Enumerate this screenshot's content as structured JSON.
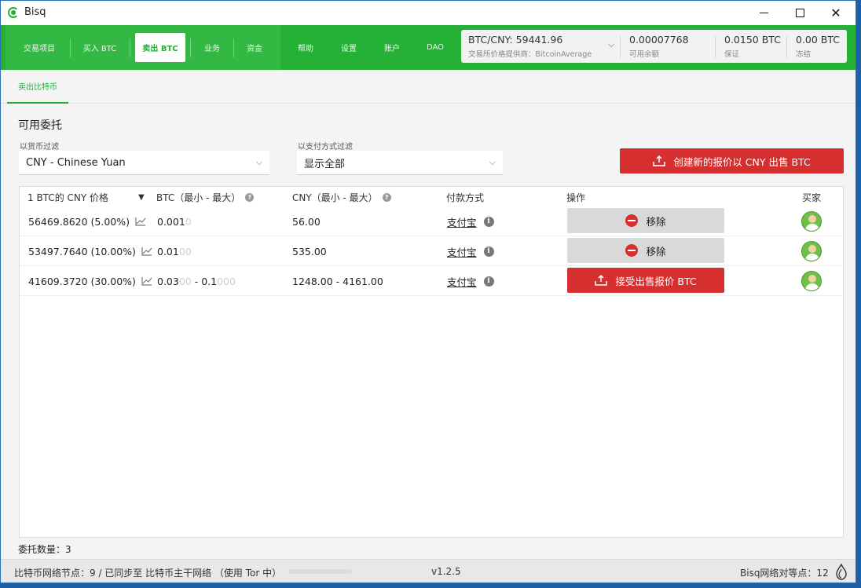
{
  "window": {
    "title": "Bisq"
  },
  "nav": {
    "items": [
      {
        "label": "交易项目"
      },
      {
        "label": "买入 BTC"
      },
      {
        "label": "卖出 BTC"
      },
      {
        "label": "业务"
      },
      {
        "label": "资金"
      },
      {
        "label": "帮助"
      },
      {
        "label": "设置"
      },
      {
        "label": "账户"
      },
      {
        "label": "DAO"
      }
    ],
    "active_index": 2
  },
  "balances": {
    "price": {
      "value": "BTC/CNY: 59441.96",
      "label": "交易所价格提供商：BitcoinAverage"
    },
    "available": {
      "value": "0.00007768",
      "label": "可用余额"
    },
    "reserved": {
      "value": "0.0150 BTC",
      "label": "保证"
    },
    "locked": {
      "value": "0.00 BTC",
      "label": "冻结"
    }
  },
  "subtab": {
    "label": "卖出比特币"
  },
  "section": {
    "title": "可用委托"
  },
  "filters": {
    "currency": {
      "label": "以货币过滤",
      "value": "CNY  -  Chinese Yuan"
    },
    "payment": {
      "label": "以支付方式过滤",
      "value": "显示全部"
    }
  },
  "create_button": {
    "label": "创建新的报价以 CNY 出售 BTC"
  },
  "table": {
    "headers": {
      "price": "1 BTC的 CNY 价格",
      "amount": "BTC（最小 - 最大）",
      "volume": "CNY（最小 - 最大）",
      "payment": "付款方式",
      "action": "操作",
      "buyer": "买家"
    },
    "rows": [
      {
        "price": "56469.8620 (5.00%)",
        "amount_a": "0.001",
        "amount_a_pad": "0",
        "amount_sep": "",
        "amount_b": "",
        "amount_b_pad": "",
        "volume": "56.00",
        "payment": "支付宝",
        "action": "移除",
        "action_type": "remove"
      },
      {
        "price": "53497.7640 (10.00%)",
        "amount_a": "0.01",
        "amount_a_pad": "00",
        "amount_sep": "",
        "amount_b": "",
        "amount_b_pad": "",
        "volume": "535.00",
        "payment": "支付宝",
        "action": "移除",
        "action_type": "remove"
      },
      {
        "price": "41609.3720 (30.00%)",
        "amount_a": "0.03",
        "amount_a_pad": "00",
        "amount_sep": " - ",
        "amount_b": "0.1",
        "amount_b_pad": "000",
        "volume": "1248.00 - 4161.00",
        "payment": "支付宝",
        "action": "接受出售报价 BTC",
        "action_type": "take"
      }
    ]
  },
  "footer": {
    "count": "委托数量：3"
  },
  "status": {
    "left": "比特币网络节点：9 / 已同步至 比特币主干网络 （使用 Tor 中）",
    "version": "v1.2.5",
    "peers": "Bisq网络对等点：12"
  }
}
